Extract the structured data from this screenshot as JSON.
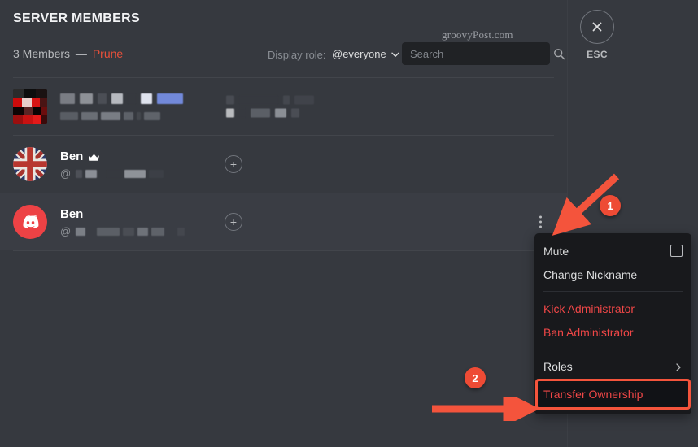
{
  "header": {
    "title": "SERVER MEMBERS",
    "member_count_text": "3 Members",
    "dash": "—",
    "prune_label": "Prune",
    "display_role_label": "Display role:",
    "role_value": "@everyone",
    "role_chevron_icon": "chevron-down-icon",
    "search_placeholder": "Search",
    "search_value": "",
    "search_icon": "search-icon",
    "watermark": "groovyPost.com",
    "close_icon": "close-x-icon",
    "esc_label": "ESC"
  },
  "members": [
    {
      "name_redacted": true,
      "name": "",
      "handle_prefix": "",
      "handle_redacted": true,
      "avatar_type": "pixel-red-black-avatar",
      "has_crown": false,
      "hovered": false,
      "right_cell": "redacted-role-badges"
    },
    {
      "name_redacted": false,
      "name": "Ben",
      "handle_prefix": "@",
      "handle_redacted": true,
      "avatar_type": "union-flag-avatar",
      "has_crown": true,
      "crown_icon": "crown-icon",
      "hovered": false,
      "right_cell": "add-role-button",
      "add_role_label": "+"
    },
    {
      "name_redacted": false,
      "name": "Ben",
      "handle_prefix": "@",
      "handle_redacted": true,
      "avatar_type": "discord-logo-avatar",
      "has_crown": false,
      "hovered": true,
      "right_cell": "add-role-button",
      "add_role_label": "+",
      "kebab_icon": "more-options-icon"
    }
  ],
  "context_menu": {
    "items": [
      {
        "label": "Mute",
        "kind": "normal",
        "trailing": "checkbox"
      },
      {
        "label": "Change Nickname",
        "kind": "normal",
        "trailing": "none"
      },
      {
        "separator": true
      },
      {
        "label": "Kick Administrator",
        "kind": "danger",
        "trailing": "none"
      },
      {
        "label": "Ban Administrator",
        "kind": "danger",
        "trailing": "none"
      },
      {
        "separator": true
      },
      {
        "label": "Roles",
        "kind": "normal",
        "trailing": "submenu-arrow"
      },
      {
        "label": "Transfer Ownership",
        "kind": "danger",
        "trailing": "none",
        "highlighted": true
      }
    ]
  },
  "annotations": {
    "step_one": "1",
    "step_two": "2",
    "arrow_color": "#f4543c",
    "highlight_color": "#f4543c"
  },
  "colors": {
    "app_background": "#36393f",
    "menu_background": "#18191c",
    "danger_text": "#f04747",
    "prune_text": "#e8503a",
    "discord_red": "#ed4245",
    "accent_marker": "#ee4b35"
  }
}
